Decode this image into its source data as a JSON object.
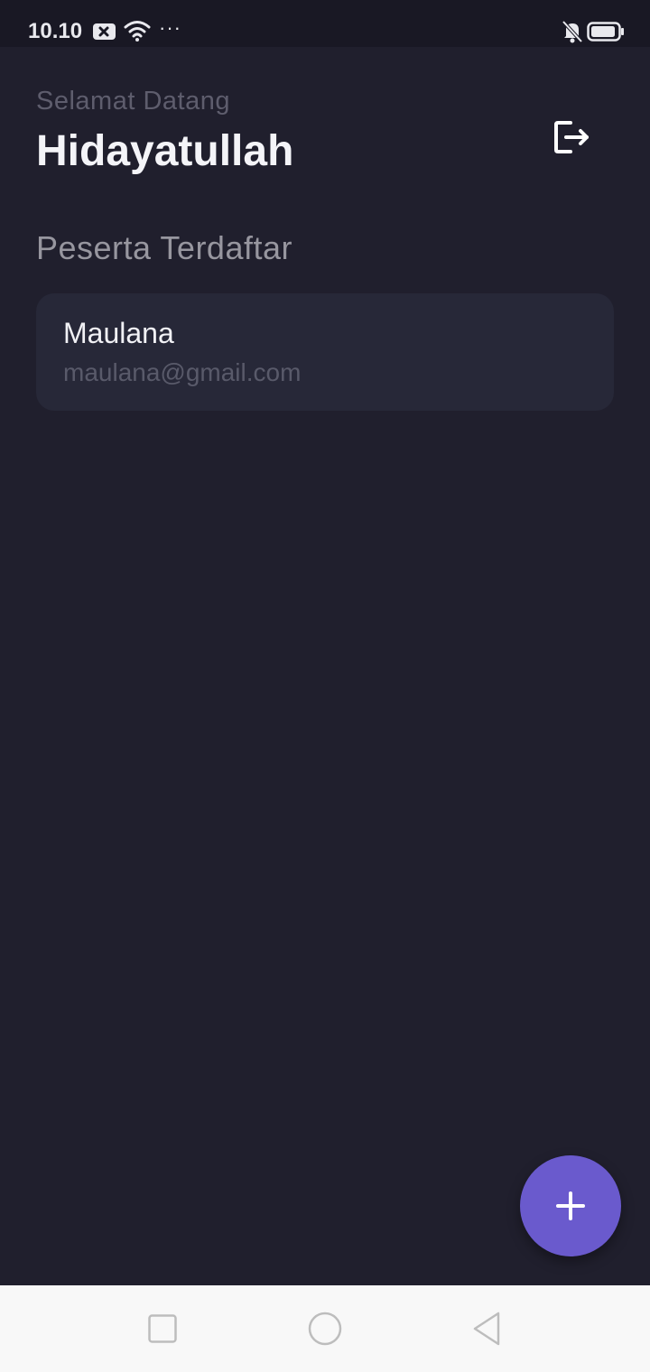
{
  "status_bar": {
    "time": "10.10",
    "more_indicator": "···",
    "icons": [
      "notification-x-icon",
      "wifi-icon",
      "bell-off-icon",
      "battery-icon"
    ]
  },
  "header": {
    "greeting": "Selamat Datang",
    "user_name": "Hidayatullah",
    "logout_icon": "logout-icon"
  },
  "section": {
    "title": "Peserta Terdaftar"
  },
  "participants": [
    {
      "name": "Maulana",
      "email": "maulana@gmail.com"
    }
  ],
  "fab": {
    "icon": "plus-icon"
  },
  "navigation": {
    "buttons": [
      "recents-square-icon",
      "home-circle-icon",
      "back-triangle-icon"
    ]
  },
  "colors": {
    "background": "#201f2d",
    "card": "#272838",
    "accent": "#6a5acd",
    "text_primary": "#f4f4f8",
    "text_muted": "#5e5d6d"
  }
}
